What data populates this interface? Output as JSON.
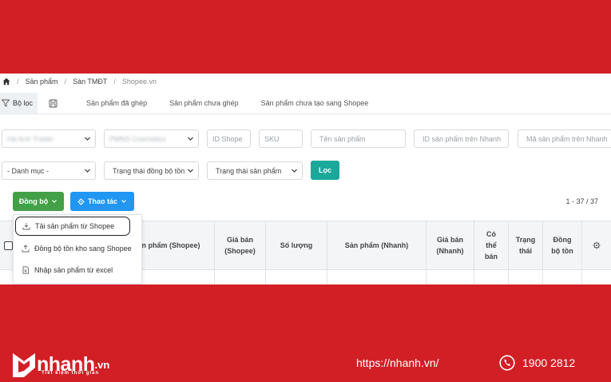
{
  "breadcrumb": {
    "items": [
      "Sản phẩm",
      "Sàn TMĐT",
      "Shopee.vn"
    ]
  },
  "tabs": [
    {
      "label": "Bộ lọc"
    },
    {
      "label": "Sản phẩm đã ghép"
    },
    {
      "label": "Sản phẩm chưa ghép"
    },
    {
      "label": "Sản phẩm chưa tạo sang Shopee"
    }
  ],
  "filters": {
    "shop_select": "Hà Anh Trader",
    "store_select": "PMNS Cosmetics",
    "id_shopee_placeholder": "ID Shope",
    "sku_placeholder": "SKU",
    "product_name_placeholder": "Tên sản phẩm",
    "id_nhanh_placeholder": "ID sản phẩm trên Nhanh",
    "code_nhanh_placeholder": "Mã sản phẩm trên Nhanh",
    "category_select": "- Danh mục -",
    "sync_status_select": "Trạng thái đồng bộ tồn",
    "product_status_select": "Trạng thái sản phẩm",
    "filter_button": "Lọc"
  },
  "actions": {
    "sync_button": "Đồng bộ",
    "operations_button": "Thao tác",
    "pagination": "1 - 37 / 37"
  },
  "dropdown": {
    "items": [
      "Tải sản phẩm từ Shopee",
      "Đồng bộ tồn kho sang Shopee",
      "Nhập sản phẩm từ excel"
    ]
  },
  "table": {
    "headers": {
      "product_shopee": "n phẩm (Shopee)",
      "price_shopee_1": "Giá bán",
      "price_shopee_2": "(Shopee)",
      "quantity": "Số lượng",
      "product_nhanh": "Sản phẩm (Nhanh)",
      "price_nhanh_1": "Giá bán",
      "price_nhanh_2": "(Nhanh)",
      "can_sell_1": "Có",
      "can_sell_2": "thể",
      "can_sell_3": "bán",
      "status_1": "Trạng",
      "status_2": "thái",
      "sync_stock_1": "Đồng",
      "sync_stock_2": "bộ tồn"
    }
  },
  "footer": {
    "brand": "nhanh",
    "brand_tld": ".vn",
    "tagline": "Tiết kiệm thời gian",
    "url": "https://nhanh.vn/",
    "phone": "1900 2812"
  },
  "colors": {
    "background_red": "#d21f26",
    "teal_button": "#1aa89b",
    "green_button": "#43a047",
    "blue_button": "#2196f3"
  }
}
